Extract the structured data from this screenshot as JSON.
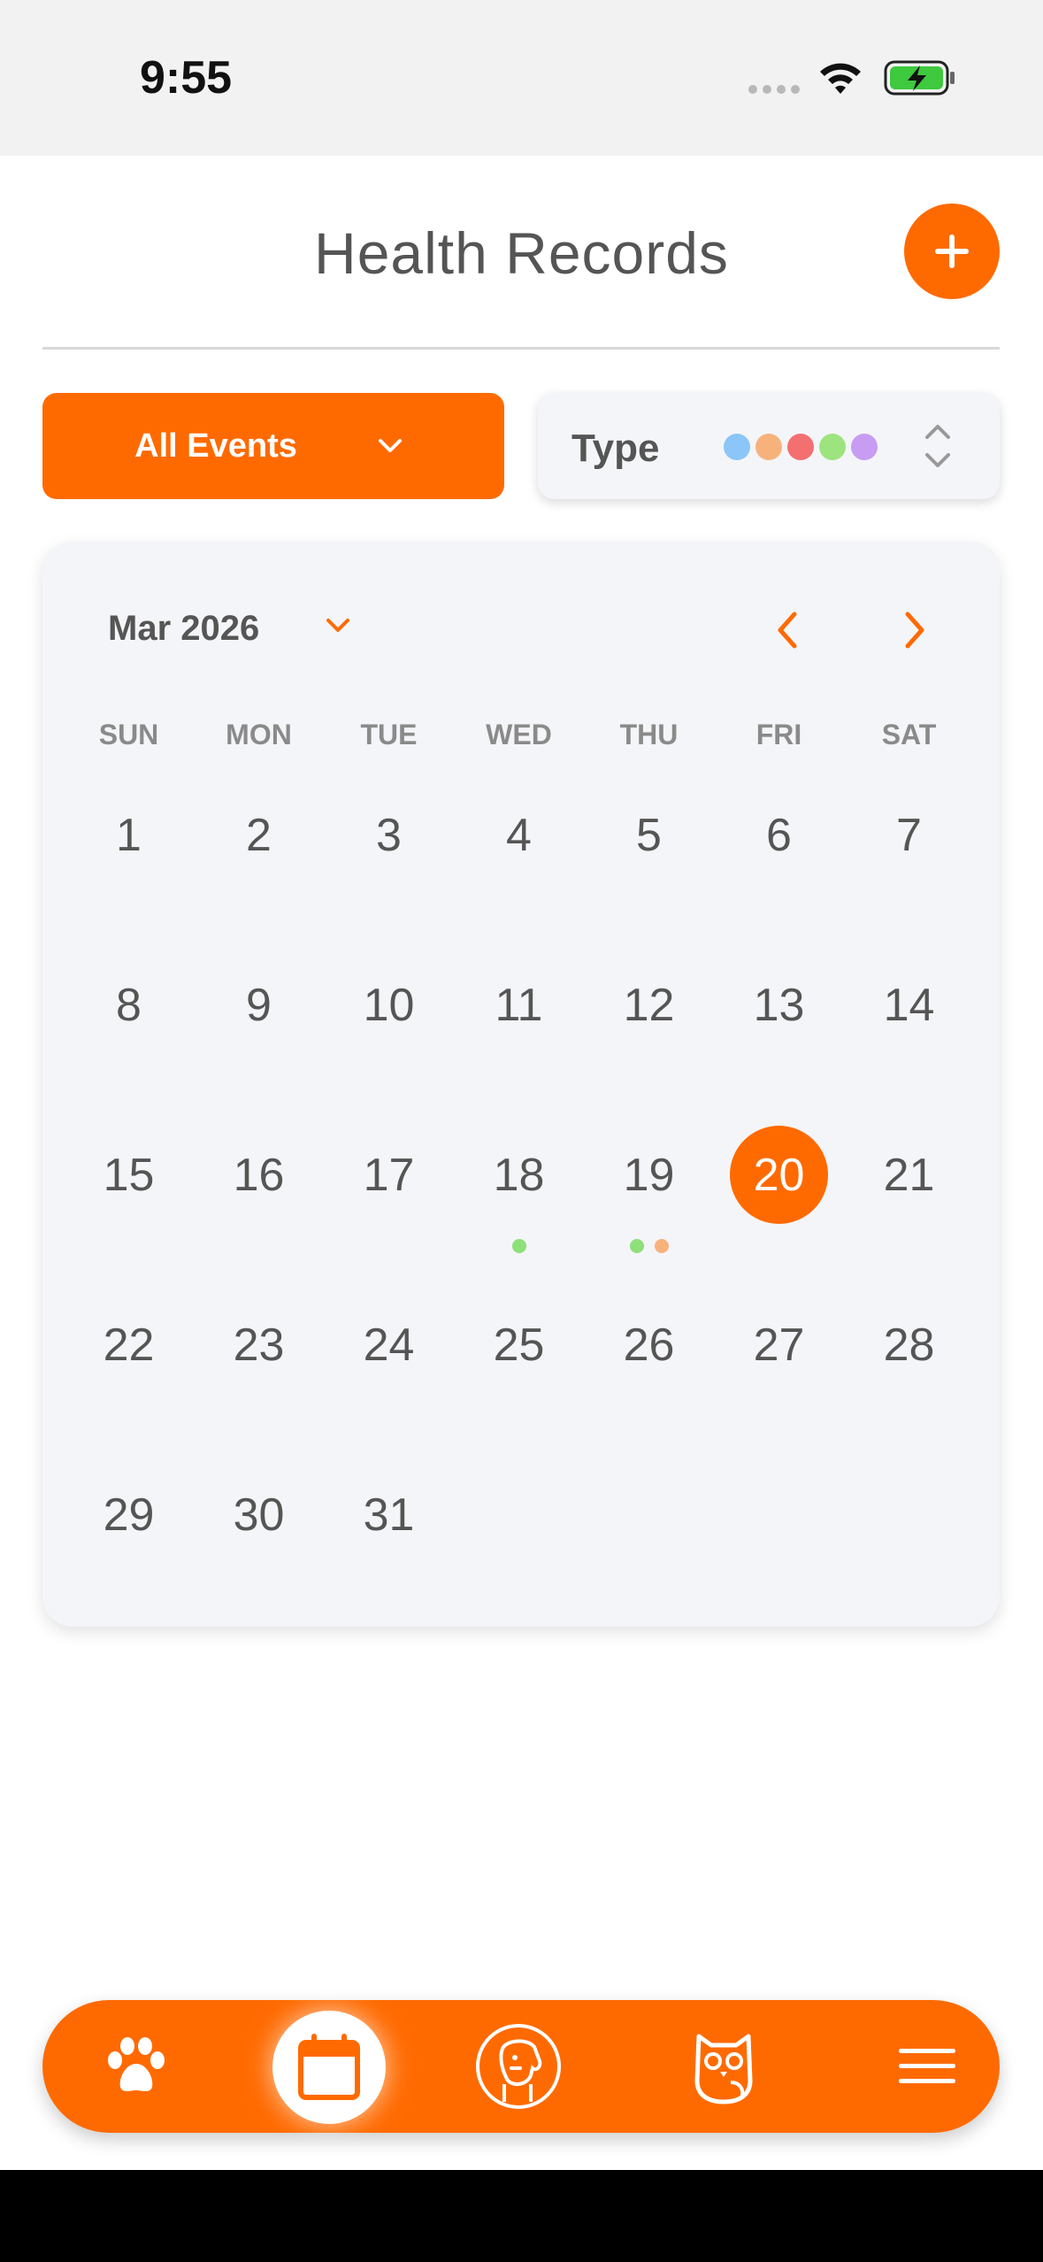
{
  "status_bar": {
    "time": "9:55"
  },
  "header": {
    "title": "Health Records",
    "add_icon": "plus-icon"
  },
  "filters": {
    "events_dropdown_label": "All Events",
    "type_label": "Type",
    "type_colors": [
      "#8cc5f7",
      "#f7b27c",
      "#f46f6f",
      "#9de47f",
      "#c79cf2"
    ]
  },
  "calendar": {
    "month_label": "Mar 2026",
    "weekdays": [
      "SUN",
      "MON",
      "TUE",
      "WED",
      "THU",
      "FRI",
      "SAT"
    ],
    "first_weekday_index": 0,
    "days_in_month": 31,
    "selected_day": 20,
    "event_markers": {
      "18": [
        "#8de07a"
      ],
      "19": [
        "#8de07a",
        "#f7b27c"
      ]
    }
  },
  "bottom_nav": {
    "items": [
      "paw-icon",
      "calendar-icon",
      "vet-dog-icon",
      "owl-icon",
      "menu-icon"
    ],
    "active_index": 1
  },
  "colors": {
    "accent": "#ff6a00",
    "card_bg": "#f4f5f8",
    "text": "#555555"
  }
}
